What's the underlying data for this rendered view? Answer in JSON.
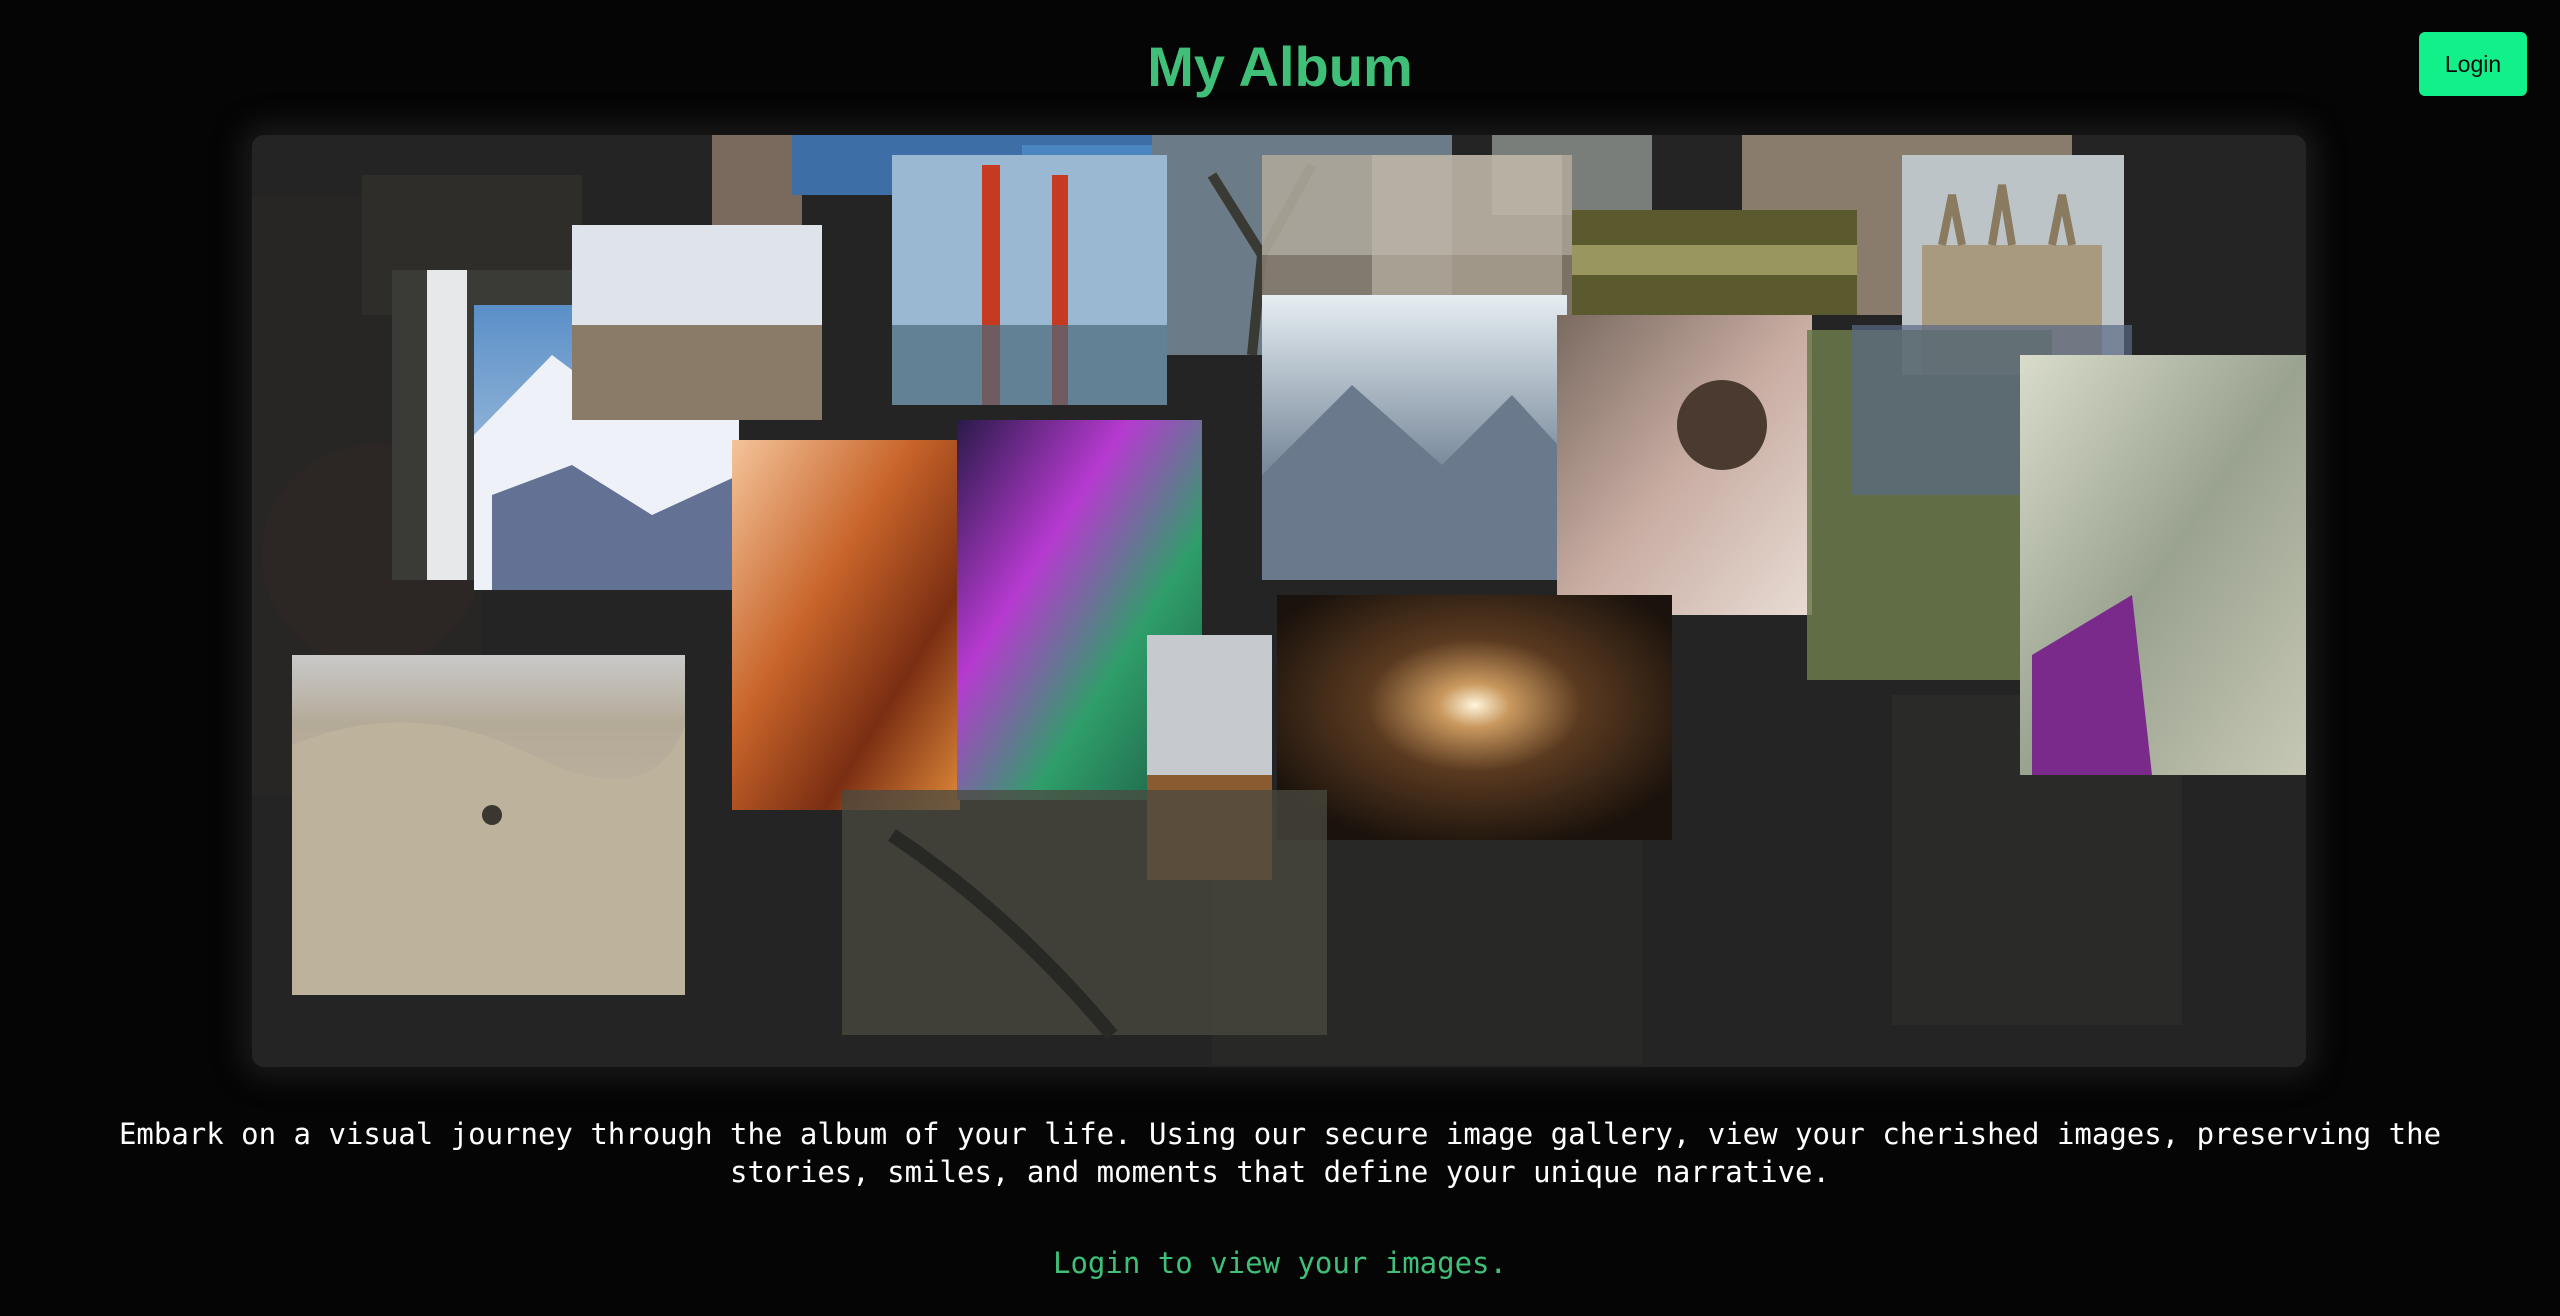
{
  "header": {
    "title": "My Album",
    "login_label": "Login"
  },
  "intro": {
    "description": "Embark on a visual journey through the album of your life. Using our secure image gallery, view your cherished images, preserving the stories, smiles, and moments that define your unique narrative.",
    "prompt": "Login to view your images."
  },
  "colors": {
    "background": "#050505",
    "accent": "#3fbf78",
    "button": "#12f08a",
    "panel": "#242424"
  },
  "collage": {
    "photos": [
      "faded-background-photo",
      "waterfall-photo",
      "snowy-mountain-photo",
      "beach-photo",
      "golden-gate-bridge-photo",
      "tree-photo",
      "blurred-motion-photo",
      "guitar-neck-photo",
      "cathedral-photo",
      "mountain-lake-photo",
      "pug-in-blanket-photo",
      "grassy-field-photo",
      "woman-in-purple-dress-photo",
      "antelope-canyon-photo",
      "aurora-photo",
      "coastline-photo",
      "tunnel-light-photo",
      "desert-dunes-photo",
      "tree-shadow-photo"
    ]
  }
}
